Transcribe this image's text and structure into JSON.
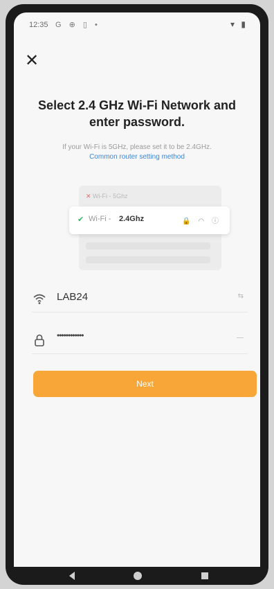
{
  "status_bar": {
    "time": "12:35",
    "icons": "G ⊕ ▯ •",
    "right_icons": "▾ ▮"
  },
  "close": {
    "icon": "close-icon",
    "glyph": "✕"
  },
  "title": "Select 2.4 GHz Wi-Fi Network and enter password.",
  "hint": "If your Wi-Fi is 5GHz, please set it to be 2.4GHz.",
  "link": "Common router setting method",
  "illustration": {
    "row_5ghz_wifi": "Wi-Fi -",
    "row_5ghz_band": "5Ghz",
    "row_24_wifi": "Wi-Fi -",
    "row_24_band": "2.4Ghz",
    "row_24_icons": "🔒 ◠ ⓘ"
  },
  "ssid_field": {
    "value": "LAB24",
    "right": "⇆"
  },
  "password_field": {
    "value": "••••••••••••",
    "right": "—"
  },
  "next_button": "Next",
  "colors": {
    "accent": "#f7a637",
    "link": "#3d87d8"
  }
}
